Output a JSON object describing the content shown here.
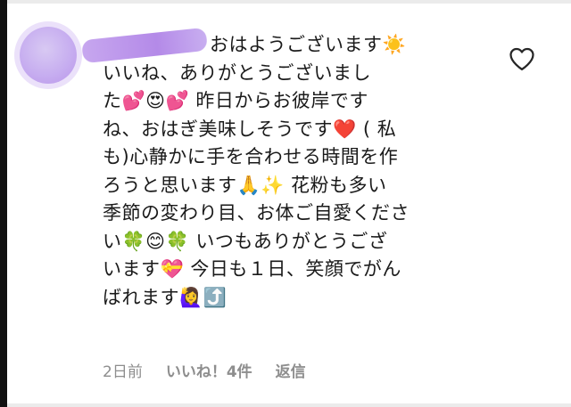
{
  "comment": {
    "lines": [
      "おはようございます☀️",
      "いいね、ありがとうございまし",
      "た💕😍💕 昨日からお彼岸です",
      "ね、おはぎ美味しそうです❤️ ( 私",
      "も)心静かに手を合わせる時間を作",
      "ろうと思います🙏✨ 花粉も多い",
      "季節の変わり目、お体ご自愛くださ",
      "い🍀😊🍀 いつもありがとうござ",
      "います💝 今日も１日、笑顔でがん",
      "ばれます🙋‍♀️⤴️"
    ]
  },
  "footer": {
    "time": "2日前",
    "likes": "いいね！4件",
    "reply": "返信"
  },
  "icons": {
    "like": "heart-outline-icon"
  },
  "colors": {
    "text": "#1a1a1a",
    "meta": "#8e8e8e",
    "redaction": "#c3a6ef"
  }
}
